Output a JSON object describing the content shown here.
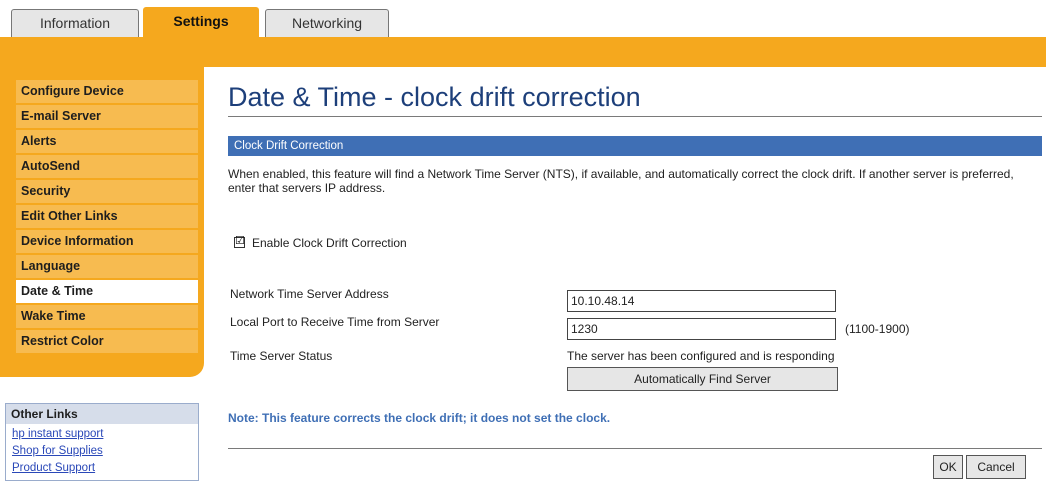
{
  "tabs": [
    {
      "label": "Information"
    },
    {
      "label": "Settings"
    },
    {
      "label": "Networking"
    }
  ],
  "nav": {
    "items": [
      {
        "label": "Configure Device"
      },
      {
        "label": "E-mail Server"
      },
      {
        "label": "Alerts"
      },
      {
        "label": "AutoSend"
      },
      {
        "label": "Security"
      },
      {
        "label": "Edit Other Links"
      },
      {
        "label": "Device Information"
      },
      {
        "label": "Language"
      },
      {
        "label": "Date & Time"
      },
      {
        "label": "Wake Time"
      },
      {
        "label": "Restrict Color"
      }
    ],
    "active": "Date & Time"
  },
  "other_links": {
    "heading": "Other Links",
    "items": [
      {
        "label": "hp instant support"
      },
      {
        "label": "Shop for Supplies"
      },
      {
        "label": "Product Support"
      }
    ]
  },
  "main": {
    "title": "Date & Time - clock drift correction",
    "section_heading": "Clock Drift Correction",
    "description": "When enabled, this feature will find a Network Time Server (NTS), if available, and automatically correct the clock drift. If another server is preferred, enter that servers IP address.",
    "enable_checkbox": {
      "label": "Enable Clock Drift Correction",
      "checked": true,
      "mark": "☑"
    },
    "server_address": {
      "label": "Network Time Server Address",
      "value": "10.10.48.14"
    },
    "local_port": {
      "label": "Local Port to Receive Time from Server",
      "value": "1230",
      "range": "(1100-1900)"
    },
    "status": {
      "label": "Time Server Status",
      "value": "The server has been configured and is responding"
    },
    "find_button": "Automatically Find Server",
    "note": "Note: This feature corrects the clock drift; it does not set the clock.",
    "ok_button": "OK",
    "cancel_button": "Cancel"
  },
  "colors": {
    "accent_orange": "#f5a81e",
    "nav_item_bg": "#f7bb50",
    "title_blue": "#1d3f7a",
    "section_blue": "#3f6fb5",
    "link_blue": "#2a48b8"
  }
}
